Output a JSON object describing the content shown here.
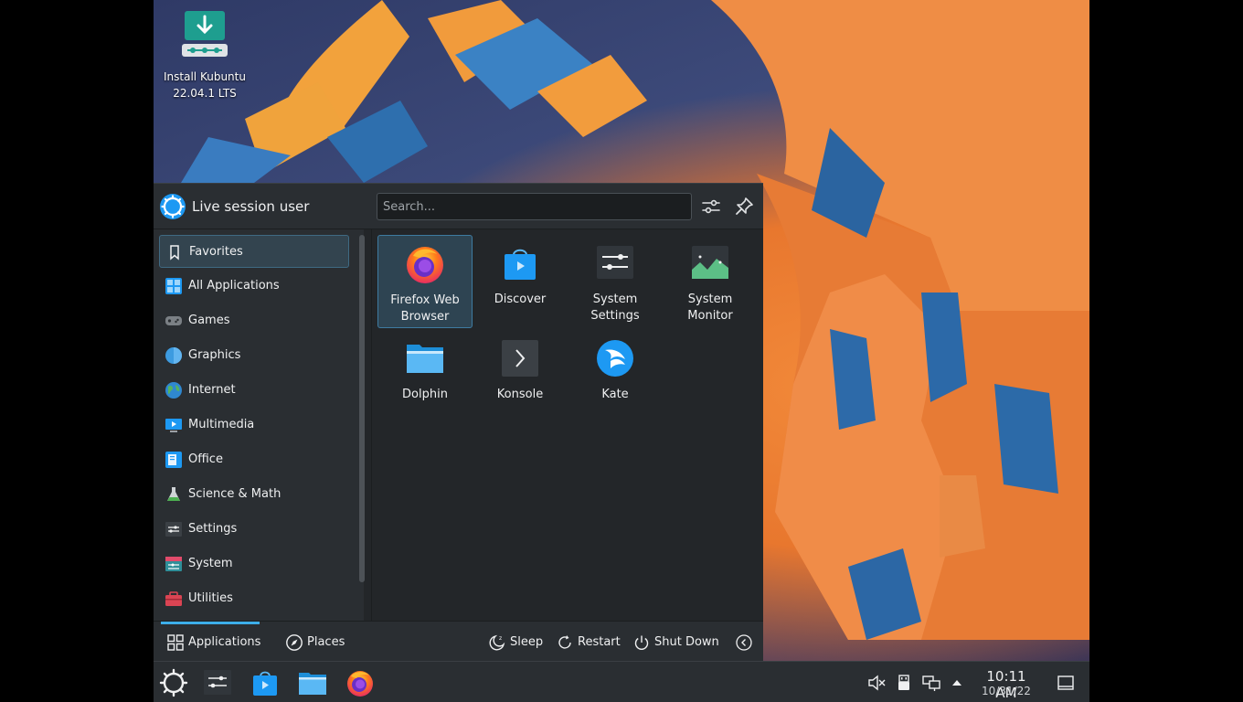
{
  "desktop": {
    "install_label_line1": "Install Kubuntu",
    "install_label_line2": "22.04.1 LTS"
  },
  "launcher": {
    "user_name": "Live session user",
    "search_placeholder": "Search...",
    "categories": [
      {
        "label": "Favorites",
        "icon": "bookmark-icon"
      },
      {
        "label": "All Applications",
        "icon": "grid-icon"
      },
      {
        "label": "Games",
        "icon": "gamepad-icon"
      },
      {
        "label": "Graphics",
        "icon": "graphics-icon"
      },
      {
        "label": "Internet",
        "icon": "globe-icon"
      },
      {
        "label": "Multimedia",
        "icon": "multimedia-icon"
      },
      {
        "label": "Office",
        "icon": "office-icon"
      },
      {
        "label": "Science & Math",
        "icon": "flask-icon"
      },
      {
        "label": "Settings",
        "icon": "settings-icon"
      },
      {
        "label": "System",
        "icon": "system-icon"
      },
      {
        "label": "Utilities",
        "icon": "toolbox-icon"
      }
    ],
    "apps": [
      {
        "line1": "Firefox Web",
        "line2": "Browser",
        "icon": "firefox-icon"
      },
      {
        "line1": "Discover",
        "line2": "",
        "icon": "discover-icon"
      },
      {
        "line1": "System",
        "line2": "Settings",
        "icon": "system-settings-icon"
      },
      {
        "line1": "System",
        "line2": "Monitor",
        "icon": "system-monitor-icon"
      },
      {
        "line1": "Dolphin",
        "line2": "",
        "icon": "folder-icon"
      },
      {
        "line1": "Konsole",
        "line2": "",
        "icon": "terminal-icon"
      },
      {
        "line1": "Kate",
        "line2": "",
        "icon": "kate-icon"
      }
    ],
    "footer": {
      "applications": "Applications",
      "places": "Places",
      "sleep": "Sleep",
      "restart": "Restart",
      "shutdown": "Shut Down"
    }
  },
  "taskbar": {
    "time": "10:11 AM",
    "date": "10/31/22"
  },
  "colors": {
    "accent": "#3daee9",
    "panel": "#2a2e32",
    "background": "#232629"
  }
}
